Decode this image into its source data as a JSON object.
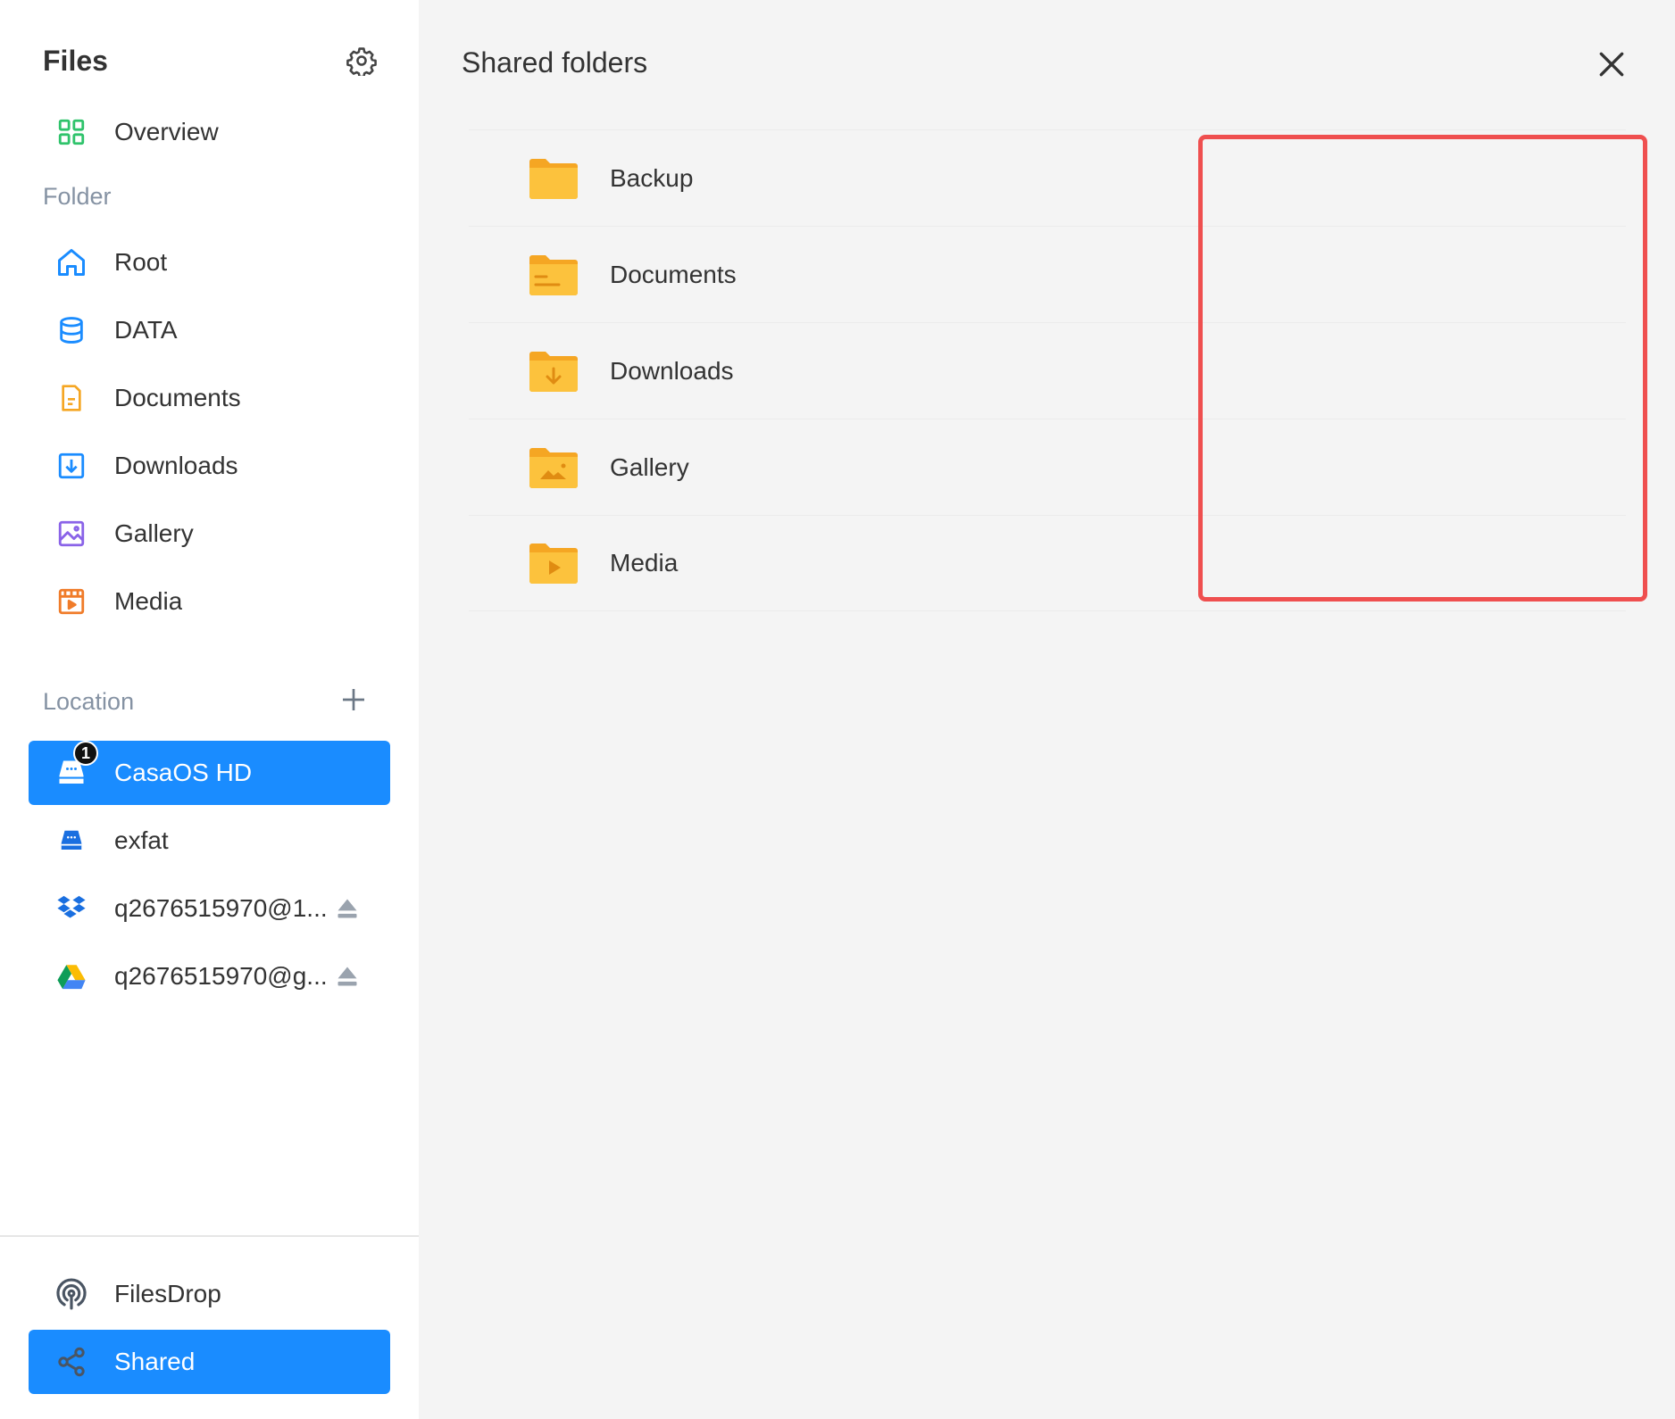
{
  "sidebar": {
    "title": "Files",
    "overview_label": "Overview",
    "folder_section": "Folder",
    "folders": [
      {
        "label": "Root",
        "icon": "home-icon"
      },
      {
        "label": "DATA",
        "icon": "database-icon"
      },
      {
        "label": "Documents",
        "icon": "document-icon"
      },
      {
        "label": "Downloads",
        "icon": "download-icon"
      },
      {
        "label": "Gallery",
        "icon": "image-icon"
      },
      {
        "label": "Media",
        "icon": "media-icon"
      }
    ],
    "location_section": "Location",
    "locations": [
      {
        "label": "CasaOS HD",
        "icon": "drive-icon",
        "badge": "1",
        "active": true
      },
      {
        "label": "exfat",
        "icon": "drive-icon"
      },
      {
        "label": "q2676515970@1...",
        "icon": "dropbox-icon",
        "ejectable": true
      },
      {
        "label": "q2676515970@g...",
        "icon": "google-drive-icon",
        "ejectable": true
      }
    ],
    "filesdrop_label": "FilesDrop",
    "shared_label": "Shared"
  },
  "main": {
    "title": "Shared folders",
    "folders": [
      {
        "name": "Backup",
        "icon": "folder-icon"
      },
      {
        "name": "Documents",
        "icon": "folder-document-icon"
      },
      {
        "name": "Downloads",
        "icon": "folder-download-icon"
      },
      {
        "name": "Gallery",
        "icon": "folder-gallery-icon"
      },
      {
        "name": "Media",
        "icon": "folder-media-icon"
      }
    ]
  },
  "colors": {
    "accent": "#1a8cff",
    "highlight": "#ef4f4f",
    "folder": "#fbb730",
    "muted": "#8592a3"
  }
}
